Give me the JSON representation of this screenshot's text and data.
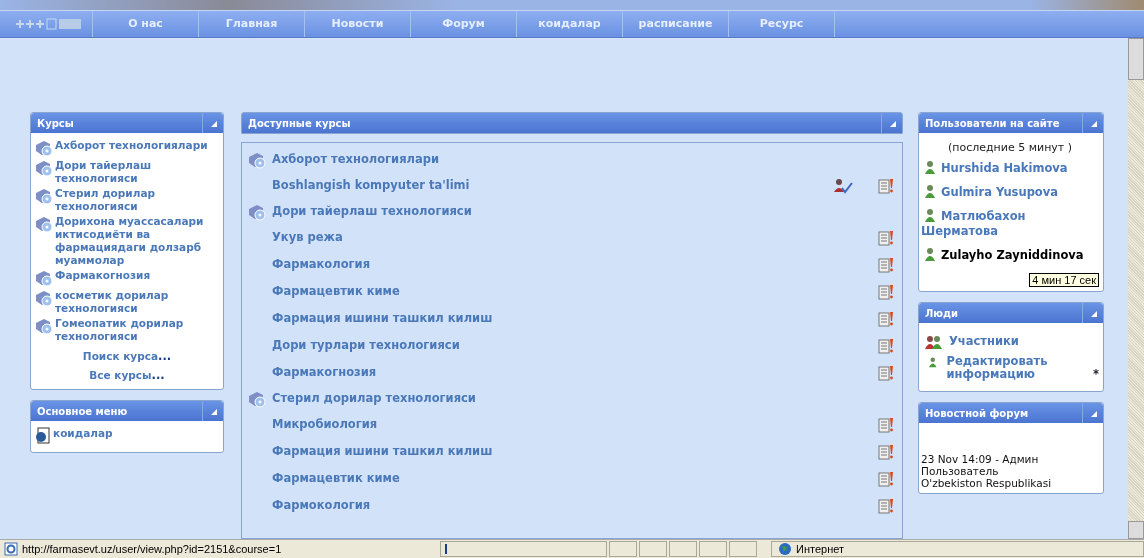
{
  "nav": {
    "items": [
      {
        "label": "О нас",
        "selected": false
      },
      {
        "label": "Главная",
        "selected": false
      },
      {
        "label": "Новости",
        "selected": false
      },
      {
        "label": "Форум",
        "selected": false
      },
      {
        "label": "коидалар",
        "selected": false
      },
      {
        "label": "расписание",
        "selected": false
      },
      {
        "label": "Ресурс",
        "selected": false
      }
    ]
  },
  "courses_block": {
    "title": "Курсы",
    "items": [
      "Ахборот технологиялари",
      "Дори тайерлаш технологияси",
      "Стерил дорилар технологияси",
      "Дорихона муассасалари иктисодиёти ва фармациядаги долзарб муаммолар",
      "Фармакогнозия",
      "косметик дорилар технологияси",
      "Гомеопатик дорилар технологияси"
    ],
    "links": [
      "Поиск курса",
      "Все курсы"
    ],
    "ellipsis": "..."
  },
  "main_menu": {
    "title": "Основное меню",
    "items": [
      "коидалар"
    ]
  },
  "available_courses": {
    "title": "Доступные курсы",
    "categories": [
      {
        "name": "Ахборот технологиялари",
        "courses": [
          {
            "name": "Boshlangish kompyuter ta'limi",
            "self_enrol": true
          }
        ]
      },
      {
        "name": "Дори тайерлаш технологияси",
        "courses": [
          {
            "name": "Укув режа",
            "self_enrol": false
          },
          {
            "name": "Фармакология",
            "self_enrol": false
          },
          {
            "name": "Фармацевтик киме",
            "self_enrol": false
          },
          {
            "name": "Фармация ишини ташкил килиш",
            "self_enrol": false
          },
          {
            "name": "Дори турлари технологияси",
            "self_enrol": false
          },
          {
            "name": "Фармакогнозия",
            "self_enrol": false
          }
        ]
      },
      {
        "name": "Стерил дорилар технологияси",
        "courses": [
          {
            "name": "Микробиология",
            "self_enrol": false
          },
          {
            "name": "Фармация ишини ташкил килиш",
            "self_enrol": false
          },
          {
            "name": "Фармацевтик киме",
            "self_enrol": false
          },
          {
            "name": "Фармокология",
            "self_enrol": false
          }
        ]
      }
    ]
  },
  "online_users": {
    "title": "Пользователи на сайте",
    "note": "(последние 5 минут )",
    "users": [
      {
        "name": "Hurshida Hakimova",
        "hovered": false
      },
      {
        "name": "Gulmira Yusupova",
        "hovered": false
      },
      {
        "name": "Матлюбахон Шерматова",
        "hovered": false
      },
      {
        "name": "Zulayho Zayniddinova",
        "hovered": true
      }
    ],
    "tooltip": "4 мин 17 сек"
  },
  "people": {
    "title": "Люди",
    "items": [
      {
        "kind": "group",
        "label": "Участники"
      },
      {
        "kind": "person",
        "label": "Редактировать информацию",
        "suffix": "*"
      }
    ]
  },
  "news_forum": {
    "title": "Новостной форум",
    "lines": [
      "23 Nov 14:09 - Админ",
      "Пользователь",
      "O'zbekiston Respublikasi"
    ]
  },
  "status_bar": {
    "url": "http://farmasevt.uz/user/view.php?id=2151&course=1",
    "zone": "Интернет"
  }
}
